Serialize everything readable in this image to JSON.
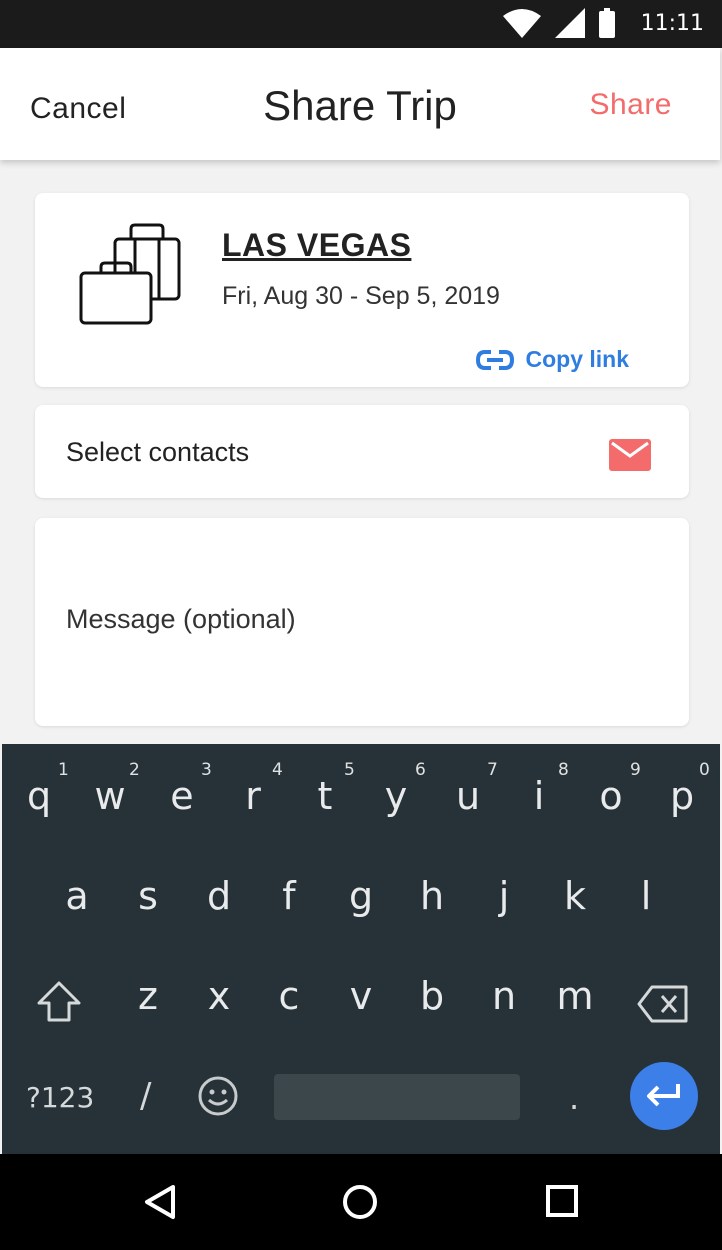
{
  "status_bar": {
    "time": "11:11",
    "icons": [
      "wifi-icon",
      "signal-icon",
      "battery-icon"
    ]
  },
  "app_bar": {
    "cancel_label": "Cancel",
    "title": "Share Trip",
    "share_label": "Share"
  },
  "trip": {
    "icon": "luggage-icon",
    "destination": "LAS VEGAS",
    "dates": "Fri, Aug 30 - Sep 5, 2019",
    "copy_link_label": "Copy link"
  },
  "contacts": {
    "label": "Select contacts",
    "icon": "mail-icon"
  },
  "message": {
    "placeholder": "Message (optional)"
  },
  "keyboard": {
    "row1": [
      {
        "ch": "q",
        "num": "1"
      },
      {
        "ch": "w",
        "num": "2"
      },
      {
        "ch": "e",
        "num": "3"
      },
      {
        "ch": "r",
        "num": "4"
      },
      {
        "ch": "t",
        "num": "5"
      },
      {
        "ch": "y",
        "num": "6"
      },
      {
        "ch": "u",
        "num": "7"
      },
      {
        "ch": "i",
        "num": "8"
      },
      {
        "ch": "o",
        "num": "9"
      },
      {
        "ch": "p",
        "num": "0"
      }
    ],
    "row2": [
      "a",
      "s",
      "d",
      "f",
      "g",
      "h",
      "j",
      "k",
      "l"
    ],
    "row3": [
      "z",
      "x",
      "c",
      "v",
      "b",
      "n",
      "m"
    ],
    "symbols_label": "?123",
    "slash_label": "/",
    "period_label": "."
  },
  "colors": {
    "accent": "#f46b6b",
    "link": "#2f7de1",
    "keyboard_bg": "#263238",
    "enter_key": "#3d7fe8"
  }
}
